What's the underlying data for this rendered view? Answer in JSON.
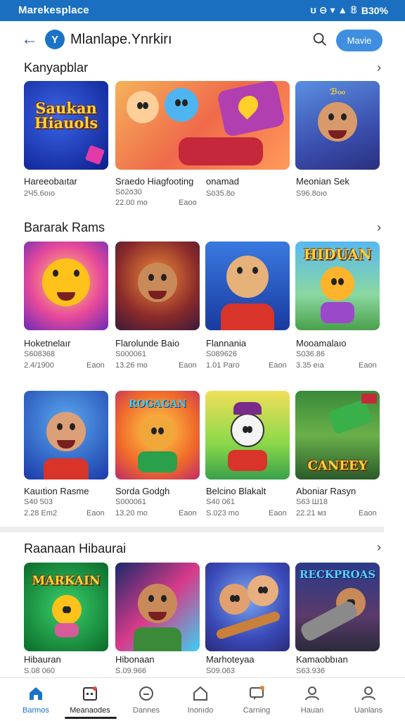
{
  "status_bar": {
    "title": "Marekesplace",
    "icons_text": "ʊ ⊖ ▾ ▲ 𝟠",
    "battery": "B30%"
  },
  "app_bar": {
    "logo_glyph": "Y",
    "title": "Mlanlape.Ynrkirı",
    "cta_label": "Mavie"
  },
  "sections": [
    {
      "title": "Kanyapblar",
      "items": [
        {
          "name": "Hareeobaıtar",
          "meta1": "2Ч5.6оıо",
          "meta2": "",
          "tag": "",
          "banner": "Saukan Hiauols"
        },
        {
          "name": "Sraedo Hiagfooting",
          "meta1": "Sö2ö30",
          "meta2": "22.00 mo",
          "tag": "Eaoo"
        },
        {
          "name": "onamad",
          "meta1": "Sö35.8о",
          "meta2": "",
          "tag": ""
        },
        {
          "name": "Meonian Sek",
          "meta1": "S96.8оıо",
          "meta2": "",
          "tag": ""
        }
      ]
    },
    {
      "title": "Bararak Rams",
      "items": [
        {
          "name": "Hoketnelaır",
          "meta1": "S608368",
          "meta2": "2.4/1900",
          "tag": "Eaon",
          "banner": ""
        },
        {
          "name": "Flarolunde Baio",
          "meta1": "S000061",
          "meta2": "13.26 mo",
          "tag": "Eaon",
          "banner": ""
        },
        {
          "name": "Flannania",
          "meta1": "S089626",
          "meta2": "1.01 Paro",
          "tag": "Eaon",
          "banner": ""
        },
        {
          "name": "Mooamalaıo",
          "meta1": "S036.86",
          "meta2": "3.35 eıa",
          "tag": "Eaon",
          "banner": "HIDUAN"
        }
      ]
    },
    {
      "title": "",
      "items": [
        {
          "name": "Kauıtion Rasme",
          "meta1": "S40 503",
          "meta2": "2.28 Em2",
          "tag": "Eaon",
          "banner": ""
        },
        {
          "name": "Sorda Godgh",
          "meta1": "S000061",
          "meta2": "13.20 mo",
          "tag": "Eaon",
          "banner": "ROGAGAN"
        },
        {
          "name": "Belcino Blakalt",
          "meta1": "S40 061",
          "meta2": "S.023 mo",
          "tag": "Eaon",
          "banner": ""
        },
        {
          "name": "Aboniar Rasyn",
          "meta1": "S63 Ш18",
          "meta2": "22.21 мз",
          "tag": "Eaon",
          "banner": "CANEEY"
        }
      ]
    },
    {
      "title": "Raanaan Hibaurai",
      "items": [
        {
          "name": "Hibauran",
          "meta1": "S.08 060",
          "meta2": "",
          "tag": "",
          "banner": "MARKAIN"
        },
        {
          "name": "Hibonaan",
          "meta1": "S.09.966",
          "meta2": "",
          "tag": "",
          "banner": ""
        },
        {
          "name": "Marhoteyaa",
          "meta1": "S09.063",
          "meta2": "",
          "tag": "",
          "banner": ""
        },
        {
          "name": "Kamaobbıan",
          "meta1": "S63.936",
          "meta2": "",
          "tag": "",
          "banner": "RECKPROAS"
        }
      ]
    }
  ],
  "nav": [
    {
      "label": "Barmos",
      "icon": "home-icon",
      "active": true
    },
    {
      "label": "Meanaodes",
      "icon": "calendar-icon",
      "active": false
    },
    {
      "label": "Dannes",
      "icon": "chat-icon",
      "active": false
    },
    {
      "label": "Inonıdo",
      "icon": "house-icon",
      "active": false
    },
    {
      "label": "Carning",
      "icon": "message-icon",
      "active": false
    },
    {
      "label": "Hauan",
      "icon": "person-icon",
      "active": false
    },
    {
      "label": "Uanlans",
      "icon": "profile-icon",
      "active": false
    }
  ],
  "colors": {
    "status": "#1a6fc0",
    "accent": "#3f8ee0",
    "nav_active": "#1a73c8"
  }
}
